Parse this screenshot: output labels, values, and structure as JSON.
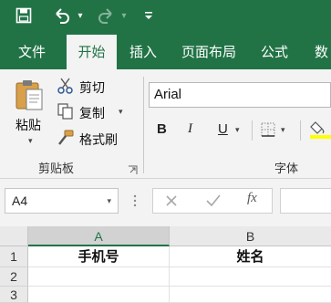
{
  "quick_access": {
    "icons": [
      "save-icon",
      "undo-icon",
      "redo-icon",
      "customize-qat-icon"
    ]
  },
  "tabs": [
    {
      "label": "文件",
      "active": false
    },
    {
      "label": "开始",
      "active": true
    },
    {
      "label": "插入",
      "active": false
    },
    {
      "label": "页面布局",
      "active": false
    },
    {
      "label": "公式",
      "active": false
    },
    {
      "label": "数",
      "active": false
    }
  ],
  "clipboard": {
    "paste_label": "粘贴",
    "cut_label": "剪切",
    "copy_label": "复制",
    "format_painter_label": "格式刷",
    "group_label": "剪贴板"
  },
  "font": {
    "font_name": "Arial",
    "bold": "B",
    "italic": "I",
    "underline": "U",
    "group_label": "字体"
  },
  "formula_bar": {
    "name_box": "A4",
    "fx_label": "fx"
  },
  "sheet": {
    "columns": [
      "A",
      "B"
    ],
    "rows": [
      "1",
      "2",
      "3"
    ],
    "cells": {
      "A1": "手机号",
      "B1": "姓名"
    },
    "selected_column": "A"
  },
  "colors": {
    "accent": "#217346",
    "ribbon": "#f3f3f3",
    "header": "#e9e9e9"
  }
}
